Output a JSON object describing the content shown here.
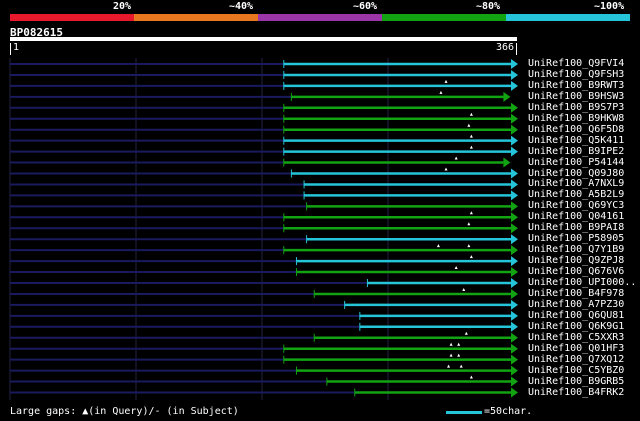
{
  "identity_scale": {
    "labels": [
      "20%",
      "~40%",
      "~60%",
      "~80%",
      "~100%"
    ],
    "colors": [
      "#e8192c",
      "#e87820",
      "#9b35a8",
      "#12a312",
      "#25c4d8"
    ]
  },
  "query": {
    "id": "BP082615",
    "start": "1",
    "end": "366",
    "length": 366
  },
  "hits": [
    {
      "name": "UniRef100_Q9FVI4",
      "start": 0.54,
      "end": 1.0,
      "color": "#25c4d8",
      "gaps": []
    },
    {
      "name": "UniRef100_Q9FSH3",
      "start": 0.54,
      "end": 1.0,
      "color": "#25c4d8",
      "gaps": []
    },
    {
      "name": "UniRef100_B9RWT3",
      "start": 0.54,
      "end": 1.0,
      "color": "#25c4d8",
      "gaps": [
        0.86
      ]
    },
    {
      "name": "UniRef100_B9HSW3",
      "start": 0.555,
      "end": 0.985,
      "color": "#12a312",
      "gaps": [
        0.85
      ]
    },
    {
      "name": "UniRef100_B9S7P3",
      "start": 0.54,
      "end": 1.0,
      "color": "#12a312",
      "gaps": []
    },
    {
      "name": "UniRef100_B9HKW8",
      "start": 0.54,
      "end": 1.0,
      "color": "#12a312",
      "gaps": [
        0.91
      ]
    },
    {
      "name": "UniRef100_Q6F5D8",
      "start": 0.54,
      "end": 1.0,
      "color": "#12a312",
      "gaps": [
        0.905
      ]
    },
    {
      "name": "UniRef100_Q5K411",
      "start": 0.54,
      "end": 1.0,
      "color": "#25c4d8",
      "gaps": [
        0.91
      ]
    },
    {
      "name": "UniRef100_B9IPE2",
      "start": 0.54,
      "end": 1.0,
      "color": "#25c4d8",
      "gaps": [
        0.91
      ]
    },
    {
      "name": "UniRef100_P54144",
      "start": 0.54,
      "end": 0.985,
      "color": "#12a312",
      "gaps": [
        0.88
      ]
    },
    {
      "name": "UniRef100_Q09J80",
      "start": 0.555,
      "end": 1.0,
      "color": "#25c4d8",
      "gaps": [
        0.86
      ]
    },
    {
      "name": "UniRef100_A7NXL9",
      "start": 0.58,
      "end": 1.0,
      "color": "#25c4d8",
      "gaps": []
    },
    {
      "name": "UniRef100_A5B2L9",
      "start": 0.58,
      "end": 1.0,
      "color": "#25c4d8",
      "gaps": []
    },
    {
      "name": "UniRef100_Q69YC3",
      "start": 0.585,
      "end": 1.0,
      "color": "#12a312",
      "gaps": []
    },
    {
      "name": "UniRef100_Q04161",
      "start": 0.54,
      "end": 1.0,
      "color": "#12a312",
      "gaps": [
        0.91
      ]
    },
    {
      "name": "UniRef100_B9PAI8",
      "start": 0.54,
      "end": 1.0,
      "color": "#12a312",
      "gaps": [
        0.905
      ]
    },
    {
      "name": "UniRef100_P58905",
      "start": 0.585,
      "end": 1.0,
      "color": "#25c4d8",
      "gaps": []
    },
    {
      "name": "UniRef100_Q7Y1B9",
      "start": 0.54,
      "end": 1.0,
      "color": "#12a312",
      "gaps": [
        0.845,
        0.905
      ]
    },
    {
      "name": "UniRef100_Q9ZPJ8",
      "start": 0.565,
      "end": 1.0,
      "color": "#25c4d8",
      "gaps": [
        0.91
      ]
    },
    {
      "name": "UniRef100_Q676V6",
      "start": 0.565,
      "end": 1.0,
      "color": "#12a312",
      "gaps": [
        0.88
      ]
    },
    {
      "name": "UniRef100_UPI000..",
      "start": 0.705,
      "end": 1.0,
      "color": "#25c4d8",
      "gaps": []
    },
    {
      "name": "UniRef100_B4F978",
      "start": 0.6,
      "end": 1.0,
      "color": "#12a312",
      "gaps": [
        0.895
      ]
    },
    {
      "name": "UniRef100_A7PZ30",
      "start": 0.66,
      "end": 1.0,
      "color": "#25c4d8",
      "gaps": []
    },
    {
      "name": "UniRef100_Q6QU81",
      "start": 0.69,
      "end": 1.0,
      "color": "#25c4d8",
      "gaps": []
    },
    {
      "name": "UniRef100_Q6K9G1",
      "start": 0.69,
      "end": 1.0,
      "color": "#25c4d8",
      "gaps": []
    },
    {
      "name": "UniRef100_C5XXR3",
      "start": 0.6,
      "end": 1.0,
      "color": "#12a312",
      "gaps": [
        0.9
      ]
    },
    {
      "name": "UniRef100_Q01HF3",
      "start": 0.54,
      "end": 1.0,
      "color": "#12a312",
      "gaps": [
        0.87,
        0.885
      ]
    },
    {
      "name": "UniRef100_Q7XQ12",
      "start": 0.54,
      "end": 1.0,
      "color": "#12a312",
      "gaps": [
        0.87,
        0.885
      ]
    },
    {
      "name": "UniRef100_C5YBZ0",
      "start": 0.565,
      "end": 1.0,
      "color": "#12a312",
      "gaps": [
        0.865,
        0.89
      ]
    },
    {
      "name": "UniRef100_B9GRB5",
      "start": 0.625,
      "end": 1.0,
      "color": "#12a312",
      "gaps": [
        0.91
      ]
    },
    {
      "name": "UniRef100_B4FRK2",
      "start": 0.68,
      "end": 1.0,
      "color": "#12a312",
      "gaps": []
    }
  ],
  "legend": {
    "gaps_text": "Large gaps: ▲(in Query)/- (in Subject)",
    "scale_text": "=50char."
  }
}
